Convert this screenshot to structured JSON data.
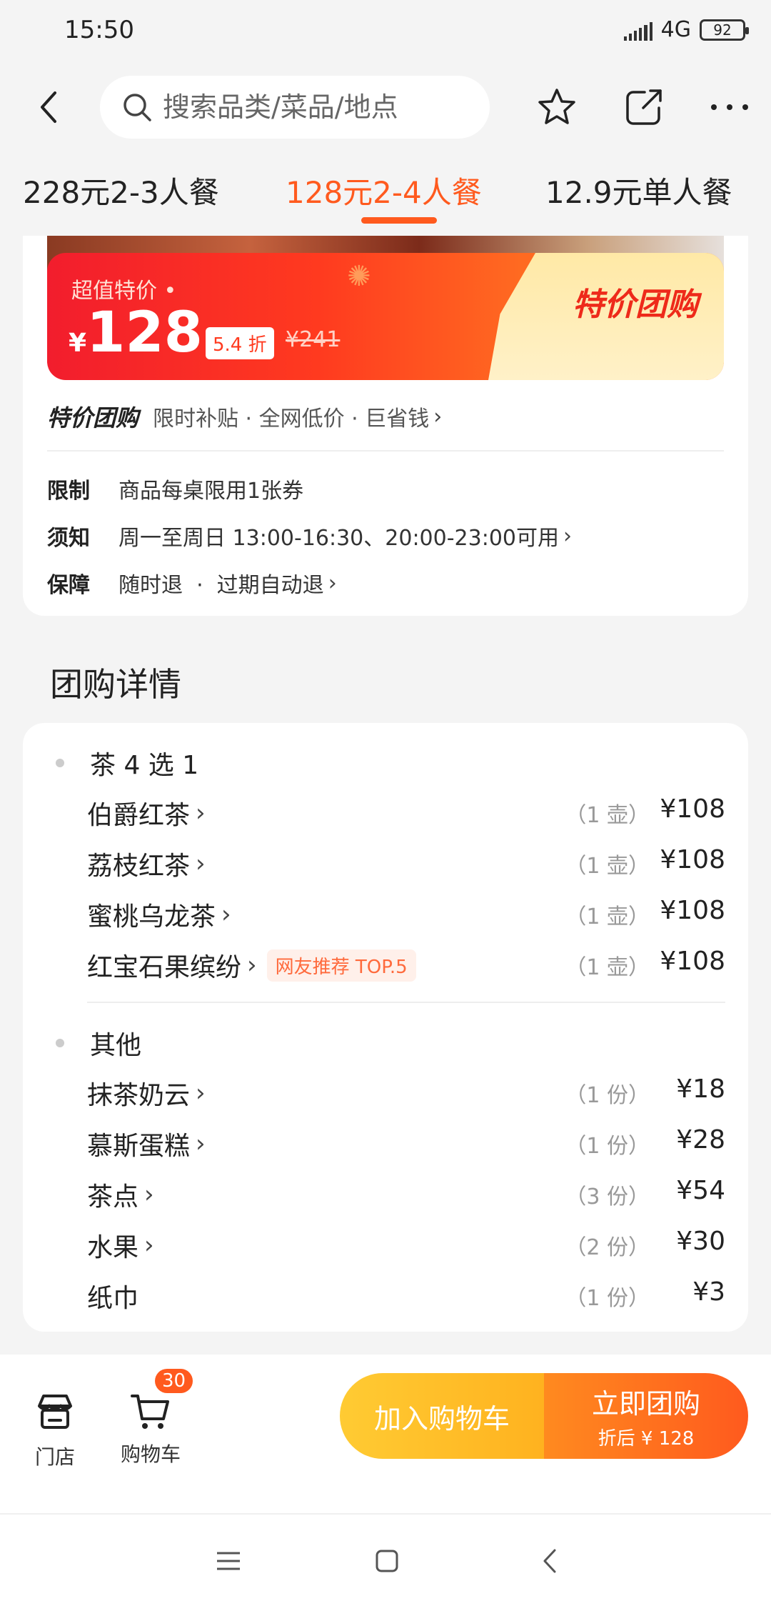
{
  "status_bar": {
    "time": "15:50",
    "network": "4G",
    "battery": "92"
  },
  "header": {
    "search_placeholder": "搜索品类/菜品/地点",
    "icons": [
      "back-icon",
      "search-icon",
      "star-icon",
      "share-icon",
      "more-icon"
    ]
  },
  "tabs": [
    {
      "label": "228元2-3人餐",
      "active": false
    },
    {
      "label": "128元2-4人餐",
      "active": true
    },
    {
      "label": "12.9元单人餐",
      "active": false
    }
  ],
  "promo": {
    "tag": "超值特价 •",
    "currency": "¥",
    "price": "128",
    "discount": "5.4 折",
    "original_price": "¥241",
    "badge": "特价团购"
  },
  "subsidy": {
    "logo": "特价团购",
    "text": "限时补贴 · 全网低价 · 巨省钱"
  },
  "info": [
    {
      "label": "限制",
      "value": "商品每桌限用1张券"
    },
    {
      "label": "须知",
      "value": "周一至周日 13:00-16:30、20:00-23:00可用"
    },
    {
      "label": "保障",
      "value": "随时退  ·  过期自动退"
    }
  ],
  "section_title": "团购详情",
  "groups": [
    {
      "title": "茶 4 选 1",
      "items": [
        {
          "name": "伯爵红茶",
          "qty": "（1 壶）",
          "price": "¥108",
          "tag": ""
        },
        {
          "name": "荔枝红茶",
          "qty": "（1 壶）",
          "price": "¥108",
          "tag": ""
        },
        {
          "name": "蜜桃乌龙茶",
          "qty": "（1 壶）",
          "price": "¥108",
          "tag": ""
        },
        {
          "name": "红宝石果缤纷",
          "qty": "（1 壶）",
          "price": "¥108",
          "tag": "网友推荐 TOP.5"
        }
      ]
    },
    {
      "title": "其他",
      "items": [
        {
          "name": "抹茶奶云",
          "qty": "（1 份）",
          "price": "¥18",
          "tag": ""
        },
        {
          "name": "慕斯蛋糕",
          "qty": "（1 份）",
          "price": "¥28",
          "tag": ""
        },
        {
          "name": "茶点",
          "qty": "（3 份）",
          "price": "¥54",
          "tag": ""
        },
        {
          "name": "水果",
          "qty": "（2 份）",
          "price": "¥30",
          "tag": ""
        },
        {
          "name": "纸巾",
          "qty": "（1 份）",
          "price": "¥3",
          "tag": ""
        }
      ]
    }
  ],
  "bottom": {
    "store_label": "门店",
    "cart_label": "购物车",
    "cart_count": "30",
    "add_cart": "加入购物车",
    "buy_now": "立即团购",
    "buy_sub": "折后 ¥ 128"
  },
  "colors": {
    "accent": "#ff5a1e",
    "promo_red": "#f21d2d",
    "cart_yellow": "#ffb21f"
  }
}
